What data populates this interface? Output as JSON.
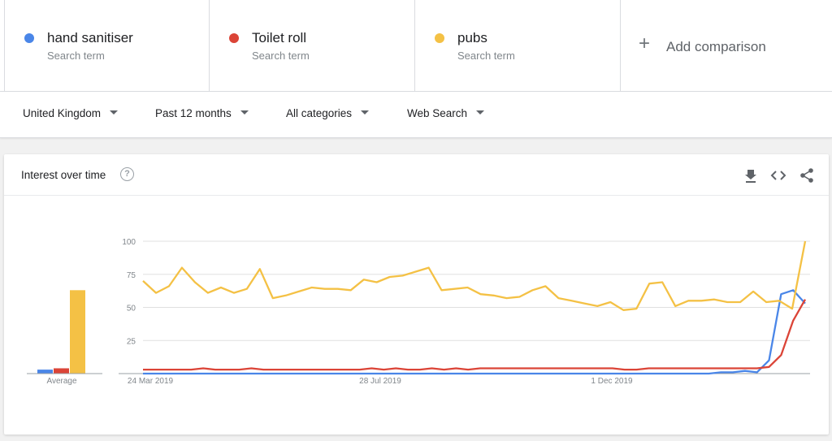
{
  "terms": [
    {
      "name": "hand sanitiser",
      "sub": "Search term",
      "color": "#4a86e8"
    },
    {
      "name": "Toilet roll",
      "sub": "Search term",
      "color": "#db4437"
    },
    {
      "name": "pubs",
      "sub": "Search term",
      "color": "#f4c145"
    }
  ],
  "add_comparison": {
    "label": "Add comparison",
    "icon": "plus-icon"
  },
  "filters": [
    {
      "label": "United Kingdom"
    },
    {
      "label": "Past 12 months"
    },
    {
      "label": "All categories"
    },
    {
      "label": "Web Search"
    }
  ],
  "card": {
    "title": "Interest over time",
    "icons": [
      "help-icon",
      "download-icon",
      "embed-code-icon",
      "share-icon"
    ]
  },
  "chart_data": {
    "type": "line",
    "ylim": [
      0,
      100
    ],
    "yticks": [
      "100",
      "75",
      "50",
      "25"
    ],
    "xtick_labels": [
      "24 Mar 2019",
      "28 Jul 2019",
      "1 Dec 2019"
    ],
    "average_label": "Average",
    "averages": [
      3,
      4,
      63
    ],
    "grid": true,
    "series": [
      {
        "name": "hand sanitiser",
        "color": "#4a86e8",
        "values": [
          0,
          0,
          0,
          0,
          0,
          0,
          0,
          0,
          0,
          0,
          0,
          0,
          0,
          0,
          0,
          0,
          0,
          0,
          0,
          0,
          0,
          0,
          0,
          0,
          0,
          0,
          0,
          0,
          0,
          0,
          0,
          0,
          0,
          0,
          0,
          0,
          0,
          0,
          0,
          0,
          0,
          0,
          0,
          0,
          0,
          0,
          0,
          0,
          1,
          1,
          2,
          1,
          10,
          60,
          63,
          53
        ]
      },
      {
        "name": "Toilet roll",
        "color": "#db4437",
        "values": [
          3,
          3,
          3,
          3,
          3,
          4,
          3,
          3,
          3,
          4,
          3,
          3,
          3,
          3,
          3,
          3,
          3,
          3,
          3,
          4,
          3,
          4,
          3,
          3,
          4,
          3,
          4,
          3,
          4,
          4,
          4,
          4,
          4,
          4,
          4,
          4,
          4,
          4,
          4,
          4,
          3,
          3,
          4,
          4,
          4,
          4,
          4,
          4,
          4,
          4,
          4,
          4,
          5,
          14,
          40,
          56
        ]
      },
      {
        "name": "pubs",
        "color": "#f4c145",
        "values": [
          70,
          61,
          66,
          80,
          69,
          61,
          65,
          61,
          64,
          79,
          57,
          59,
          62,
          65,
          64,
          64,
          63,
          71,
          69,
          73,
          74,
          77,
          80,
          63,
          64,
          65,
          60,
          59,
          57,
          58,
          63,
          66,
          57,
          55,
          53,
          51,
          54,
          48,
          49,
          68,
          69,
          51,
          55,
          55,
          56,
          54,
          54,
          62,
          54,
          55,
          49,
          100
        ]
      }
    ]
  }
}
